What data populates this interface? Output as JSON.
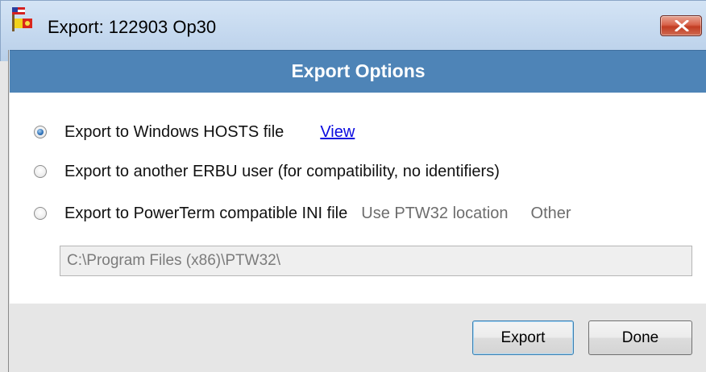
{
  "window": {
    "title": "Export: 122903 Op30",
    "icon": "erbu-flag-icon",
    "close_icon": "close-x-icon",
    "close_color": "#c94b31"
  },
  "header": {
    "title": "Export Options",
    "band_color": "#4e84b7"
  },
  "options": [
    {
      "label": "Export to Windows HOSTS file",
      "selected": true
    },
    {
      "label": "Export to another ERBU user (for compatibility, no identifiers)",
      "selected": false
    },
    {
      "label": "Export to PowerTerm compatible INI file",
      "selected": false
    }
  ],
  "hosts_view_link": "View",
  "ini_choices": {
    "use_ptw32": "Use PTW32 location",
    "other": "Other"
  },
  "path_field": {
    "value": "C:\\Program Files (x86)\\PTW32\\",
    "enabled": false
  },
  "buttons": {
    "export": "Export",
    "done": "Done"
  }
}
